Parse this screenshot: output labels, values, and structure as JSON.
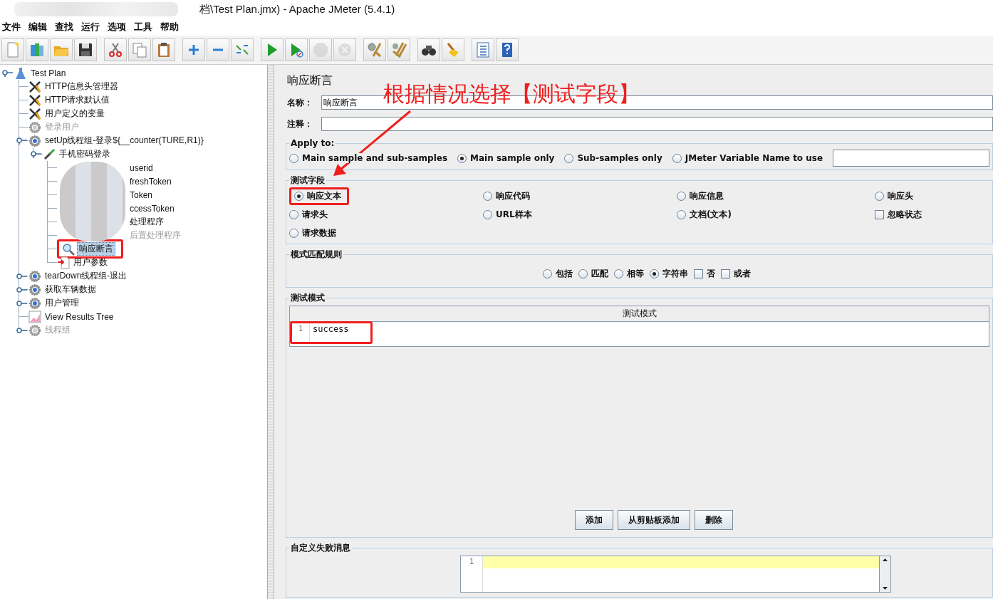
{
  "window": {
    "title": "档\\Test Plan.jmx) - Apache JMeter (5.4.1)"
  },
  "menu": [
    "文件",
    "编辑",
    "查找",
    "运行",
    "选项",
    "工具",
    "帮助"
  ],
  "toolbar": [
    [
      {
        "kind": "new",
        "disabled": false
      },
      {
        "kind": "templates",
        "disabled": false
      },
      {
        "kind": "open",
        "disabled": false
      },
      {
        "kind": "save",
        "disabled": false
      }
    ],
    [
      {
        "kind": "cut",
        "disabled": false
      },
      {
        "kind": "copy",
        "disabled": false
      },
      {
        "kind": "paste",
        "disabled": false
      }
    ],
    [
      {
        "kind": "expand",
        "disabled": false
      },
      {
        "kind": "collapse",
        "disabled": false
      },
      {
        "kind": "toggle",
        "disabled": false
      }
    ],
    [
      {
        "kind": "start",
        "disabled": false
      },
      {
        "kind": "start-no-pauses",
        "disabled": false
      },
      {
        "kind": "stop",
        "disabled": true
      },
      {
        "kind": "shutdown",
        "disabled": true
      }
    ],
    [
      {
        "kind": "clear",
        "disabled": false
      },
      {
        "kind": "clear-all",
        "disabled": false
      }
    ],
    [
      {
        "kind": "search",
        "disabled": false
      },
      {
        "kind": "reset-search",
        "disabled": false
      }
    ],
    [
      {
        "kind": "function-helper",
        "disabled": false
      },
      {
        "kind": "help",
        "disabled": false
      }
    ]
  ],
  "tree": [
    {
      "label": "Test Plan",
      "kind": "plan",
      "expanded": true,
      "disabled": false,
      "selected": false,
      "children": [
        {
          "label": "HTTP信息头管理器",
          "kind": "config",
          "disabled": false,
          "selected": false
        },
        {
          "label": "HTTP请求默认值",
          "kind": "config",
          "disabled": false,
          "selected": false
        },
        {
          "label": "用户定义的变量",
          "kind": "config",
          "disabled": false,
          "selected": false
        },
        {
          "label": "登录用户",
          "kind": "thread-group",
          "disabled": true,
          "selected": false
        },
        {
          "label": "setUp线程组-登录${__counter(TURE,R1)}",
          "kind": "thread-group",
          "expanded": true,
          "disabled": false,
          "selected": false,
          "children": [
            {
              "label": "手机密码登录",
              "kind": "sampler",
              "expanded": true,
              "disabled": false,
              "selected": false,
              "children": [
                {
                  "label": "userid",
                  "kind": "blurred",
                  "disabled": false,
                  "selected": false
                },
                {
                  "label": "freshToken",
                  "kind": "blurred",
                  "disabled": false,
                  "selected": false
                },
                {
                  "label": "Token",
                  "kind": "blurred",
                  "disabled": false,
                  "selected": false
                },
                {
                  "label": "ccessToken",
                  "kind": "blurred",
                  "disabled": false,
                  "selected": false
                },
                {
                  "label": "处理程序",
                  "kind": "blurred",
                  "disabled": false,
                  "selected": false
                },
                {
                  "label": "后置处理程序",
                  "kind": "blurred",
                  "disabled": true,
                  "selected": false
                },
                {
                  "label": "响应断言",
                  "kind": "assertion",
                  "disabled": false,
                  "selected": true,
                  "annotated": true
                },
                {
                  "label": "用户参数",
                  "kind": "parameters",
                  "disabled": false,
                  "selected": false
                }
              ]
            }
          ]
        },
        {
          "label": "tearDown线程组-退出",
          "kind": "thread-group",
          "expanded": false,
          "disabled": false,
          "selected": false
        },
        {
          "label": "获取车辆数据",
          "kind": "thread-group",
          "expanded": false,
          "disabled": false,
          "selected": false
        },
        {
          "label": "用户管理",
          "kind": "thread-group",
          "expanded": false,
          "disabled": false,
          "selected": false
        },
        {
          "label": "View Results Tree",
          "kind": "listener",
          "disabled": false,
          "selected": false
        },
        {
          "label": "线程组",
          "kind": "thread-group",
          "expanded": false,
          "disabled": true,
          "selected": false
        }
      ]
    }
  ],
  "panel": {
    "title": "响应断言",
    "name_label": "名称：",
    "name_value": "响应断言",
    "comment_label": "注释：",
    "apply_to": {
      "title": "Apply to:",
      "options": [
        {
          "label": "Main sample and sub-samples",
          "selected": false
        },
        {
          "label": "Main sample only",
          "selected": true
        },
        {
          "label": "Sub-samples only",
          "selected": false
        },
        {
          "label": "JMeter Variable Name to use",
          "selected": false
        }
      ]
    },
    "test_field": {
      "title": "测试字段",
      "options": [
        {
          "label": "响应文本",
          "kind": "radio",
          "selected": true,
          "annotated": true
        },
        {
          "label": "响应代码",
          "kind": "radio",
          "selected": false
        },
        {
          "label": "响应信息",
          "kind": "radio",
          "selected": false
        },
        {
          "label": "响应头",
          "kind": "radio",
          "selected": false
        },
        {
          "label": "请求头",
          "kind": "radio",
          "selected": false
        },
        {
          "label": "URL样本",
          "kind": "radio",
          "selected": false
        },
        {
          "label": "文档(文本)",
          "kind": "radio",
          "selected": false
        },
        {
          "label": "忽略状态",
          "kind": "checkbox",
          "checked": false
        },
        {
          "label": "请求数据",
          "kind": "radio",
          "selected": false
        }
      ]
    },
    "pattern_rules": {
      "title": "模式匹配规则",
      "options": [
        {
          "label": "包括",
          "kind": "radio",
          "selected": false
        },
        {
          "label": "匹配",
          "kind": "radio",
          "selected": false
        },
        {
          "label": "相等",
          "kind": "radio",
          "selected": false
        },
        {
          "label": "字符串",
          "kind": "radio",
          "selected": true
        },
        {
          "label": "否",
          "kind": "checkbox",
          "checked": false
        },
        {
          "label": "或者",
          "kind": "checkbox",
          "checked": false
        }
      ]
    },
    "patterns": {
      "title": "测试模式",
      "column": "测试模式",
      "rows": [
        {
          "line": "1",
          "text": "success",
          "annotated": true
        }
      ],
      "buttons": [
        "添加",
        "从剪贴板添加",
        "删除"
      ]
    },
    "failure_message": {
      "title": "自定义失败消息",
      "lines": [
        "1"
      ]
    }
  },
  "annotation": {
    "text": "根据情况选择【测试字段】"
  }
}
